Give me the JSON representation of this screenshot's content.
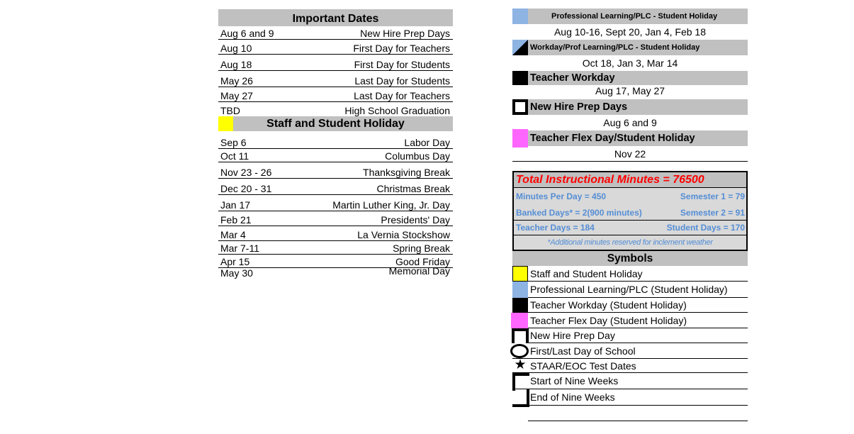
{
  "important_dates": {
    "title": "Important Dates",
    "rows": [
      {
        "date": "Aug 6 and 9",
        "event": "New Hire Prep Days"
      },
      {
        "date": "Aug 10",
        "event": "First Day for Teachers"
      },
      {
        "date": "Aug 18",
        "event": "First Day for Students"
      },
      {
        "date": "May 26",
        "event": "Last Day for Students"
      },
      {
        "date": "May 27",
        "event": "Last Day for Teachers"
      },
      {
        "date": "TBD",
        "event": "High School Graduation"
      }
    ]
  },
  "holidays": {
    "title": "Staff and Student Holiday",
    "swatch_color": "#ffff00",
    "rows": [
      {
        "date": "Sep 6",
        "event": "Labor Day"
      },
      {
        "date": "Oct 11",
        "event": "Columbus Day"
      },
      {
        "date": "Nov 23 - 26",
        "event": "Thanksgiving Break"
      },
      {
        "date": "Dec 20 - 31",
        "event": "Christmas Break"
      },
      {
        "date": "Jan 17",
        "event": "Martin Luther King, Jr. Day"
      },
      {
        "date": "Feb 21",
        "event": "Presidents' Day"
      },
      {
        "date": "Mar 4",
        "event": "La Vernia Stockshow"
      },
      {
        "date": "Mar 7-11",
        "event": "Spring Break"
      },
      {
        "date": "Apr 15",
        "event": "Good Friday"
      },
      {
        "date": "May 30",
        "event": "Memorial Day"
      }
    ]
  },
  "categories": [
    {
      "label": "Professional Learning/PLC - Student Holiday",
      "dates": "Aug 10-16, Sept 20, Jan 4, Feb 18",
      "swatch": "light-blue",
      "color": "#8eb4e3"
    },
    {
      "label": "Workday/Prof Learning/PLC - Student Holiday",
      "dates": "Oct 18, Jan 3, Mar 14",
      "swatch": "blue-black-diagonal"
    },
    {
      "label": "Teacher Workday",
      "dates": "Aug 17, May 27",
      "swatch": "black",
      "color": "#000000"
    },
    {
      "label": "New Hire Prep Days",
      "dates": "Aug 6 and 9",
      "swatch": "black-outline-box"
    },
    {
      "label": "Teacher Flex Day/Student Holiday",
      "dates": "Nov 22",
      "swatch": "pink",
      "color": "#ff66ff"
    }
  ],
  "metrics": {
    "title": "Total Instructional Minutes = 76500",
    "minutes_per_day": "Minutes Per Day = 450",
    "semester_1": "Semester 1 = 79",
    "banked_days": "Banked Days* = 2(900 minutes)",
    "semester_2": "Semester 2 = 91",
    "teacher_days": "Teacher Days = 184",
    "student_days": "Student Days = 170",
    "note": "*Additional minutes reserved for inclement weather",
    "title_color": "#ff0000",
    "text_color": "#558ed5"
  },
  "symbols": {
    "title": "Symbols",
    "items": [
      {
        "label": "Staff and Student Holiday",
        "icon": "yellow-square"
      },
      {
        "label": "Professional Learning/PLC (Student Holiday)",
        "icon": "light-blue-square"
      },
      {
        "label": "Teacher Workday (Student Holiday)",
        "icon": "black-square"
      },
      {
        "label": "Teacher Flex Day (Student Holiday)",
        "icon": "pink-square"
      },
      {
        "label": "New Hire Prep Day",
        "icon": "outline-square"
      },
      {
        "label": "First/Last Day of School",
        "icon": "circle"
      },
      {
        "label": "STAAR/EOC Test Dates",
        "icon": "star",
        "glyph": "★"
      },
      {
        "label": "Start of Nine Weeks",
        "icon": "start-bracket"
      },
      {
        "label": "End of Nine Weeks",
        "icon": "end-bracket"
      }
    ]
  }
}
